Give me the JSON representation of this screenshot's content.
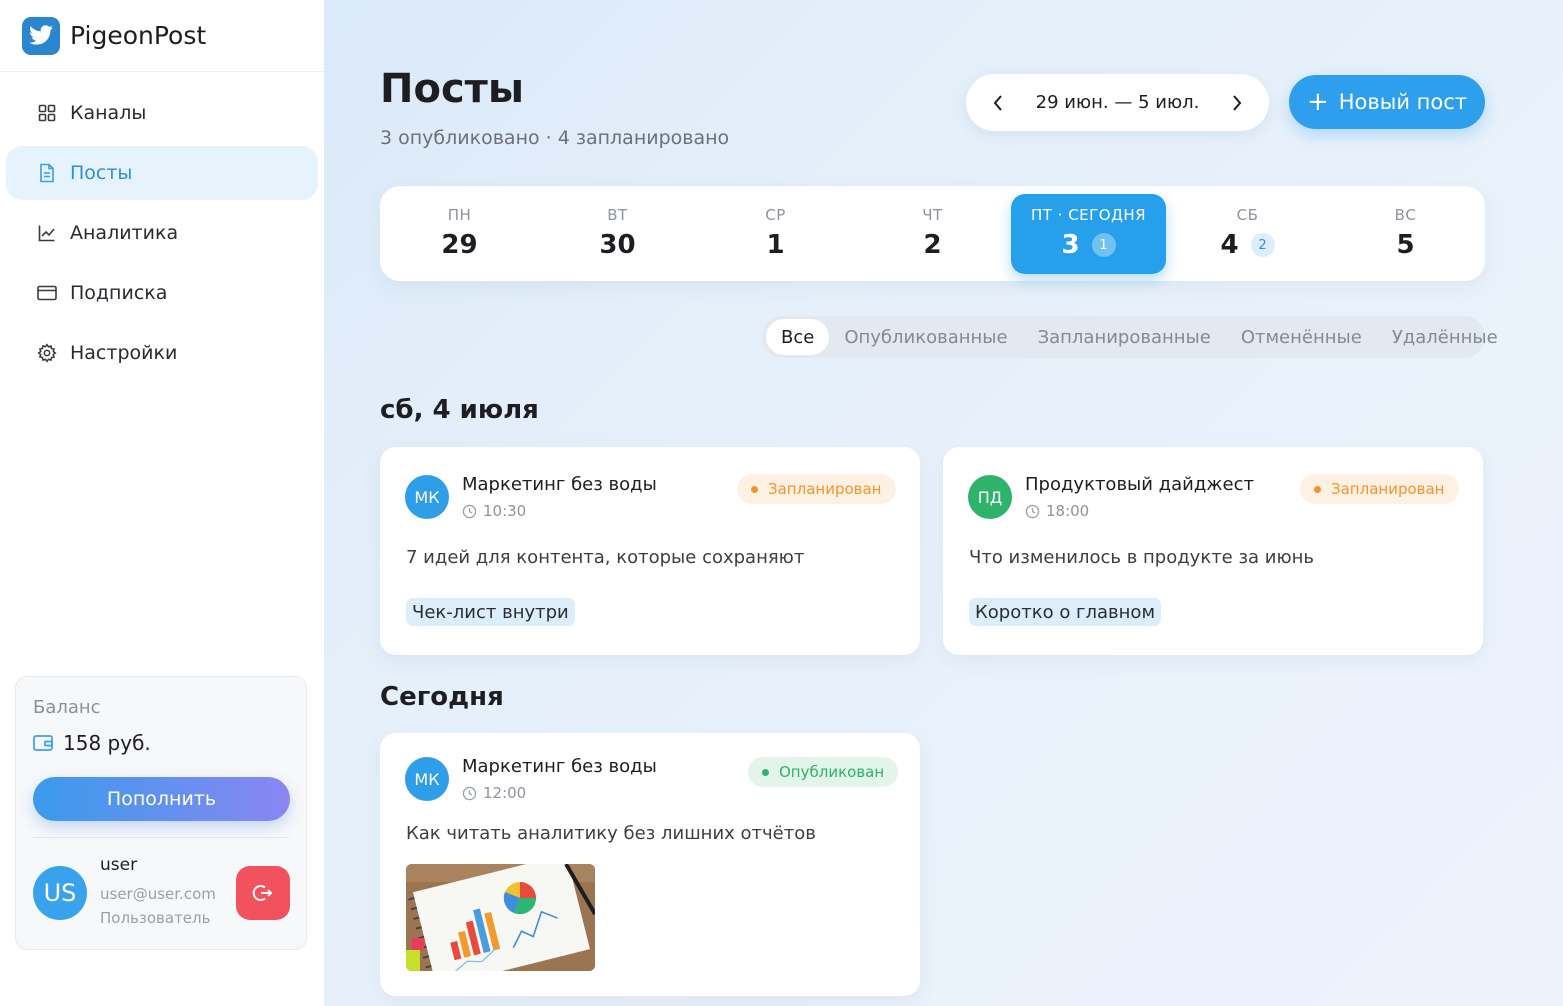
{
  "brand": {
    "name": "PigeonPost"
  },
  "sidebar": {
    "items": [
      {
        "label": "Каналы",
        "icon": "grid-icon"
      },
      {
        "label": "Посты",
        "icon": "document-icon",
        "active": true
      },
      {
        "label": "Аналитика",
        "icon": "chart-icon"
      },
      {
        "label": "Подписка",
        "icon": "card-icon"
      },
      {
        "label": "Настройки",
        "icon": "gear-icon"
      }
    ],
    "balance": {
      "label": "Баланс",
      "amount": "158 руб.",
      "topup_label": "Пополнить"
    },
    "user": {
      "initials": "US",
      "name": "user",
      "email": "user@user.com",
      "role": "Пользователь"
    }
  },
  "header": {
    "title": "Посты",
    "subtitle": "3 опубликовано · 4 запланировано",
    "date_range": "29 июн. — 5 июл.",
    "new_post_label": "Новый пост"
  },
  "week": [
    {
      "name": "ПН",
      "num": "29"
    },
    {
      "name": "ВТ",
      "num": "30"
    },
    {
      "name": "СР",
      "num": "1"
    },
    {
      "name": "ЧТ",
      "num": "2"
    },
    {
      "name": "ПТ · СЕГОДНЯ",
      "num": "3",
      "count": "1",
      "today": true
    },
    {
      "name": "СБ",
      "num": "4",
      "count": "2"
    },
    {
      "name": "ВС",
      "num": "5"
    }
  ],
  "filters": [
    "Все",
    "Опубликованные",
    "Запланированные",
    "Отменённые",
    "Удалённые"
  ],
  "sections": [
    {
      "title": "сб, 4 июля",
      "posts": [
        {
          "initials": "МК",
          "channel": "Маркетинг без воды",
          "time": "10:30",
          "status": "Запланирован",
          "text": "7 идей для контента, которые сохраняют",
          "tag": "Чек-лист внутри",
          "avatar_color": "#2f9ee9"
        },
        {
          "initials": "ПД",
          "channel": "Продуктовый дайджест",
          "time": "18:00",
          "status": "Запланирован",
          "text": "Что изменилось в продукте за июнь",
          "tag": "Коротко о главном",
          "avatar_color": "#2fb36b"
        }
      ]
    },
    {
      "title": "Сегодня",
      "posts": [
        {
          "initials": "МК",
          "channel": "Маркетинг без воды",
          "time": "12:00",
          "status": "Опубликован",
          "text": "Как читать аналитику без лишних отчётов",
          "avatar_color": "#2f9ee9"
        }
      ]
    }
  ]
}
